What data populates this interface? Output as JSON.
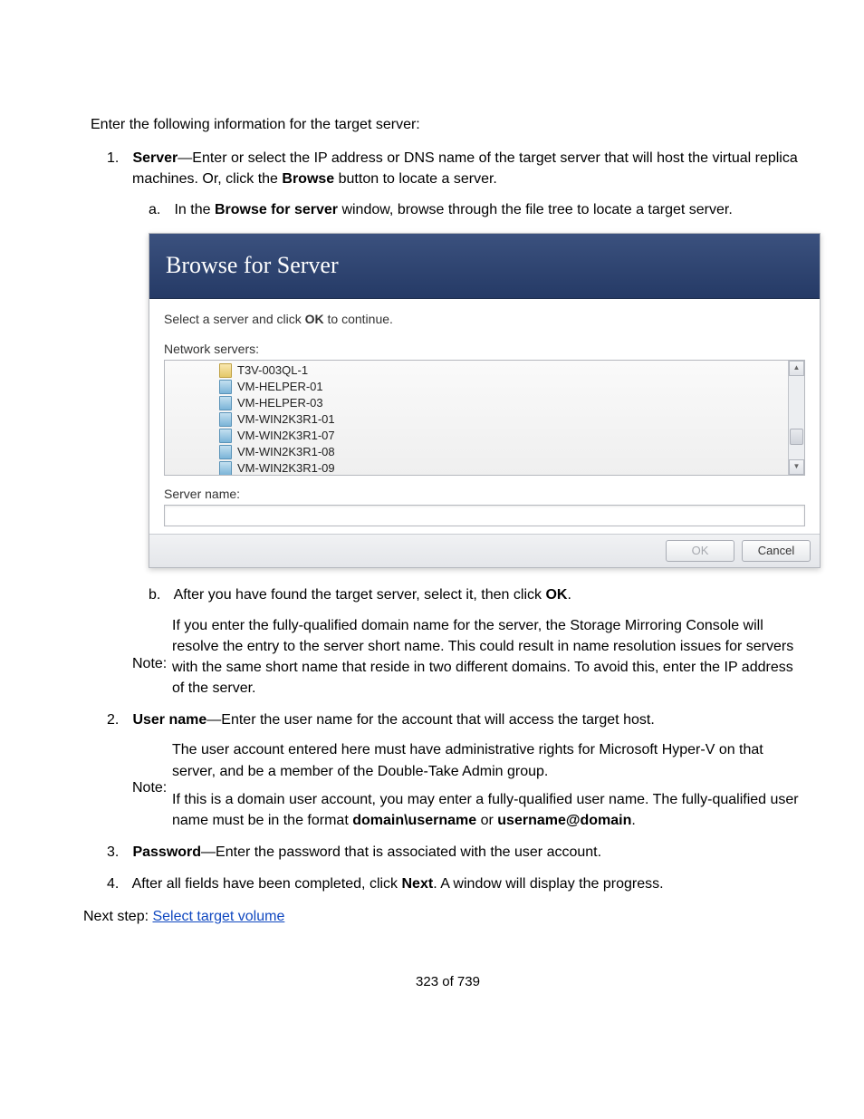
{
  "intro": "Enter the following information for the target server:",
  "list": {
    "item1": {
      "num": "1.",
      "label": "Server",
      "dash": "—",
      "text_a": "Enter or select the IP address or DNS name of the target server that will host the virtual replica machines. Or, click the ",
      "browse_bold": "Browse",
      "text_b": " button to locate a server.",
      "sub": {
        "a": {
          "alpha": "a.",
          "pre": "In the ",
          "bold": "Browse for server",
          "post": " window, browse through the file tree to locate a target server."
        },
        "b": {
          "alpha": "b.",
          "pre": "After you have found the target server, select it, then click ",
          "bold": "OK",
          "post": "."
        }
      },
      "note": {
        "label": "Note:",
        "text": "If you enter the fully-qualified domain name for the server, the Storage Mirroring Console will resolve the entry to the server short name. This could result in name resolution issues for servers with the same short name that reside in two different domains. To avoid this, enter the IP address of the server."
      }
    },
    "item2": {
      "num": "2.",
      "label": "User name",
      "dash": "—",
      "text": "Enter the user name for the account that will access the target host.",
      "note": {
        "label": "Note:",
        "text_a": "The user account entered here must have administrative rights for Microsoft Hyper-V on that server, and be a member of the Double-Take Admin group.",
        "text_b_pre": "If this is a domain user account, you may enter a fully-qualified user name. The fully-qualified user name must be in the format ",
        "bold1": "domain\\username",
        "mid": " or ",
        "bold2": "username@domain",
        "end": "."
      }
    },
    "item3": {
      "num": "3.",
      "label": "Password",
      "dash": "—",
      "text": "Enter the password that is associated with the user account."
    },
    "item4": {
      "num": "4.",
      "pre": "After all fields have been completed, click ",
      "bold": "Next",
      "post": ". A window will display the progress."
    }
  },
  "dialog": {
    "title": "Browse for Server",
    "instruction_pre": "Select a server and click ",
    "instruction_bold": "OK",
    "instruction_post": " to continue.",
    "network_label": "Network servers:",
    "servers": [
      "T3V-003QL-1",
      "VM-HELPER-01",
      "VM-HELPER-03",
      "VM-WIN2K3R1-01",
      "VM-WIN2K3R1-07",
      "VM-WIN2K3R1-08",
      "VM-WIN2K3R1-09"
    ],
    "server_name_label": "Server name:",
    "ok": "OK",
    "cancel": "Cancel"
  },
  "next_step": {
    "label": "Next step: ",
    "link": "Select target volume"
  },
  "pager": "323 of 739"
}
